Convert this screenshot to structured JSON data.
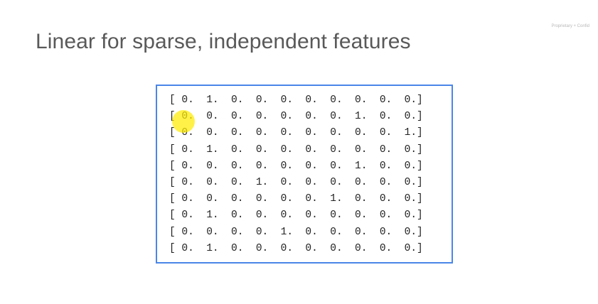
{
  "slide": {
    "title": "Linear for sparse, independent features",
    "confidential_note": "Proprietary + Confid",
    "box_color": "#4a86e8",
    "highlight_color": "#ffeb00"
  },
  "matrix": {
    "rows": [
      "[ 0.  1.  0.  0.  0.  0.  0.  0.  0.  0.]",
      "[ 0.  0.  0.  0.  0.  0.  0.  1.  0.  0.]",
      "[ 0.  0.  0.  0.  0.  0.  0.  0.  0.  1.]",
      "[ 0.  1.  0.  0.  0.  0.  0.  0.  0.  0.]",
      "[ 0.  0.  0.  0.  0.  0.  0.  1.  0.  0.]",
      "[ 0.  0.  0.  1.  0.  0.  0.  0.  0.  0.]",
      "[ 0.  0.  0.  0.  0.  0.  1.  0.  0.  0.]",
      "[ 0.  1.  0.  0.  0.  0.  0.  0.  0.  0.]",
      "[ 0.  0.  0.  0.  1.  0.  0.  0.  0.  0.]",
      "[ 0.  1.  0.  0.  0.  0.  0.  0.  0.  0.]"
    ]
  }
}
